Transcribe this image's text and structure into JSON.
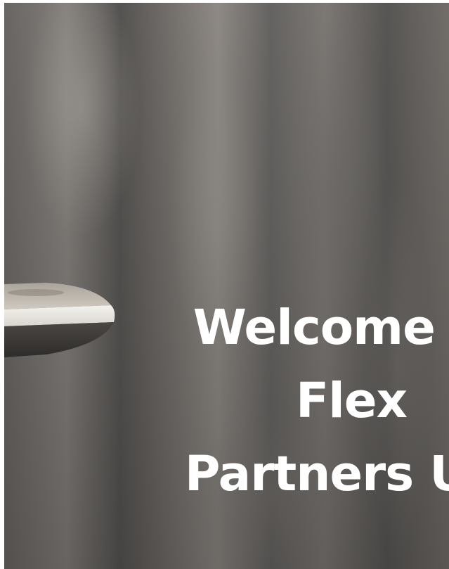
{
  "hero": {
    "title_lines": [
      "Welcome To",
      "Flex",
      "Partners Uni"
    ]
  }
}
